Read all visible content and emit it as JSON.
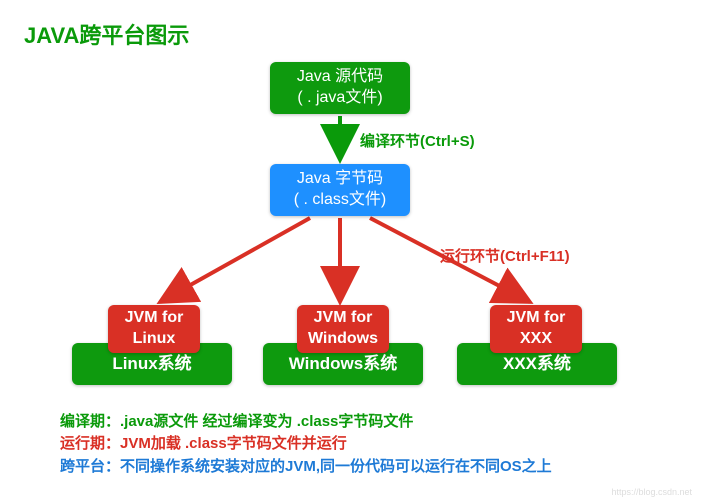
{
  "title": "JAVA跨平台图示",
  "nodes": {
    "source": {
      "line1": "Java 源代码",
      "line2": "( . java文件)"
    },
    "bytecode": {
      "line1": "Java 字节码",
      "line2": "( . class文件)"
    },
    "jvm1": {
      "line1": "JVM for",
      "line2": "Linux"
    },
    "jvm2": {
      "line1": "JVM for",
      "line2": "Windows"
    },
    "jvm3": {
      "line1": "JVM for",
      "line2": "XXX"
    },
    "os1": "Linux系统",
    "os2": "Windows系统",
    "os3": "XXX系统"
  },
  "labels": {
    "compile": "编译环节(Ctrl+S)",
    "run": "运行环节(Ctrl+F11)"
  },
  "footer": {
    "line1": "编译期：.java源文件 经过编译变为 .class字节码文件",
    "line2": "运行期：JVM加载 .class字节码文件并运行",
    "line3": "跨平台：不同操作系统安装对应的JVM,同一份代码可以运行在不同OS之上"
  },
  "chart_data": {
    "type": "diagram",
    "title": "JAVA跨平台图示",
    "nodes": [
      {
        "id": "source",
        "label": "Java 源代码 (.java文件)",
        "color": "green"
      },
      {
        "id": "bytecode",
        "label": "Java 字节码 (.class文件)",
        "color": "blue"
      },
      {
        "id": "jvm_linux",
        "label": "JVM for Linux",
        "color": "red"
      },
      {
        "id": "jvm_windows",
        "label": "JVM for Windows",
        "color": "red"
      },
      {
        "id": "jvm_xxx",
        "label": "JVM for XXX",
        "color": "red"
      },
      {
        "id": "os_linux",
        "label": "Linux系统",
        "color": "green"
      },
      {
        "id": "os_windows",
        "label": "Windows系统",
        "color": "green"
      },
      {
        "id": "os_xxx",
        "label": "XXX系统",
        "color": "green"
      }
    ],
    "edges": [
      {
        "from": "source",
        "to": "bytecode",
        "label": "编译环节(Ctrl+S)",
        "color": "green"
      },
      {
        "from": "bytecode",
        "to": "jvm_linux",
        "label": "运行环节(Ctrl+F11)",
        "color": "red"
      },
      {
        "from": "bytecode",
        "to": "jvm_windows",
        "label": "运行环节(Ctrl+F11)",
        "color": "red"
      },
      {
        "from": "bytecode",
        "to": "jvm_xxx",
        "label": "运行环节(Ctrl+F11)",
        "color": "red"
      },
      {
        "from": "jvm_linux",
        "to": "os_linux",
        "color": "none"
      },
      {
        "from": "jvm_windows",
        "to": "os_windows",
        "color": "none"
      },
      {
        "from": "jvm_xxx",
        "to": "os_xxx",
        "color": "none"
      }
    ],
    "annotations": [
      "编译期：.java源文件 经过编译变为 .class字节码文件",
      "运行期：JVM加载 .class字节码文件并运行",
      "跨平台：不同操作系统安装对应的JVM,同一份代码可以运行在不同OS之上"
    ]
  }
}
